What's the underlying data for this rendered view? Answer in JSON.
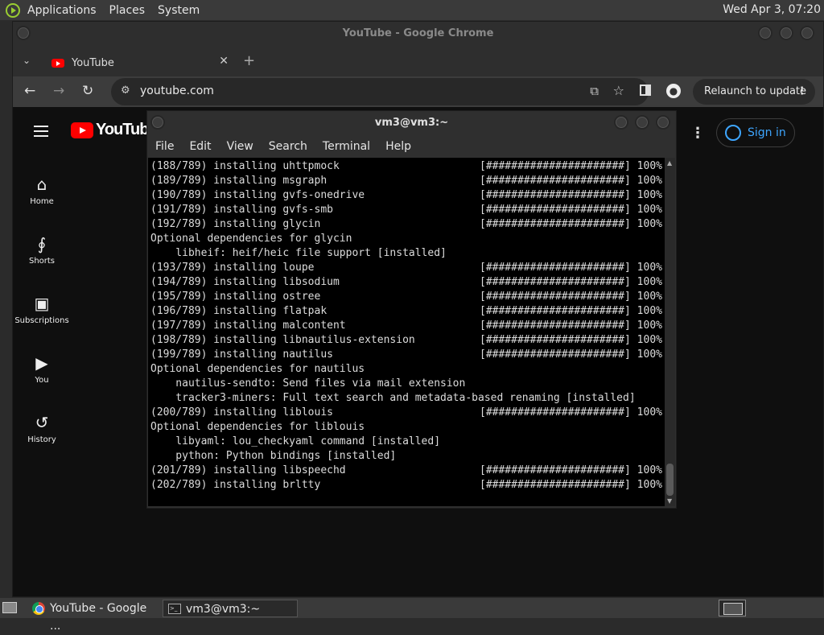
{
  "top_panel": {
    "menus": [
      "Applications",
      "Places",
      "System"
    ],
    "clock": "Wed Apr  3, 07:20"
  },
  "chrome": {
    "window_title": "YouTube - Google Chrome",
    "tab_title": "YouTube",
    "url": "youtube.com",
    "relaunch_label": "Relaunch to update"
  },
  "youtube": {
    "logo_text": "YouTube",
    "guide": [
      {
        "label": "Home",
        "icon": "home-icon"
      },
      {
        "label": "Shorts",
        "icon": "shorts-icon"
      },
      {
        "label": "Subscriptions",
        "icon": "subscriptions-icon"
      },
      {
        "label": "You",
        "icon": "you-icon"
      },
      {
        "label": "History",
        "icon": "history-icon"
      }
    ],
    "sign_in": "Sign in",
    "accent": "#3ea6ff",
    "brand": "#ff0000"
  },
  "terminal": {
    "window_title": "vm3@vm3:~",
    "menus": [
      "File",
      "Edit",
      "View",
      "Search",
      "Terminal",
      "Help"
    ],
    "lines": [
      {
        "text": "(188/789) installing uhttpmock",
        "progress": "[######################] 100%"
      },
      {
        "text": "(189/789) installing msgraph",
        "progress": "[######################] 100%"
      },
      {
        "text": "(190/789) installing gvfs-onedrive",
        "progress": "[######################] 100%"
      },
      {
        "text": "(191/789) installing gvfs-smb",
        "progress": "[######################] 100%"
      },
      {
        "text": "(192/789) installing glycin",
        "progress": "[######################] 100%"
      },
      {
        "text": "Optional dependencies for glycin",
        "progress": ""
      },
      {
        "text": "    libheif: heif/heic file support [installed]",
        "progress": ""
      },
      {
        "text": "(193/789) installing loupe",
        "progress": "[######################] 100%"
      },
      {
        "text": "(194/789) installing libsodium",
        "progress": "[######################] 100%"
      },
      {
        "text": "(195/789) installing ostree",
        "progress": "[######################] 100%"
      },
      {
        "text": "(196/789) installing flatpak",
        "progress": "[######################] 100%"
      },
      {
        "text": "(197/789) installing malcontent",
        "progress": "[######################] 100%"
      },
      {
        "text": "(198/789) installing libnautilus-extension",
        "progress": "[######################] 100%"
      },
      {
        "text": "(199/789) installing nautilus",
        "progress": "[######################] 100%"
      },
      {
        "text": "Optional dependencies for nautilus",
        "progress": ""
      },
      {
        "text": "    nautilus-sendto: Send files via mail extension",
        "progress": ""
      },
      {
        "text": "    tracker3-miners: Full text search and metadata-based renaming [installed]",
        "progress": ""
      },
      {
        "text": "(200/789) installing liblouis",
        "progress": "[######################] 100%"
      },
      {
        "text": "Optional dependencies for liblouis",
        "progress": ""
      },
      {
        "text": "    libyaml: lou_checkyaml command [installed]",
        "progress": ""
      },
      {
        "text": "    python: Python bindings [installed]",
        "progress": ""
      },
      {
        "text": "(201/789) installing libspeechd",
        "progress": "[######################] 100%"
      },
      {
        "text": "(202/789) installing brltty",
        "progress": "[######################] 100%"
      }
    ]
  },
  "taskbar": {
    "tasks": [
      "YouTube - Google ...",
      "vm3@vm3:~"
    ]
  }
}
